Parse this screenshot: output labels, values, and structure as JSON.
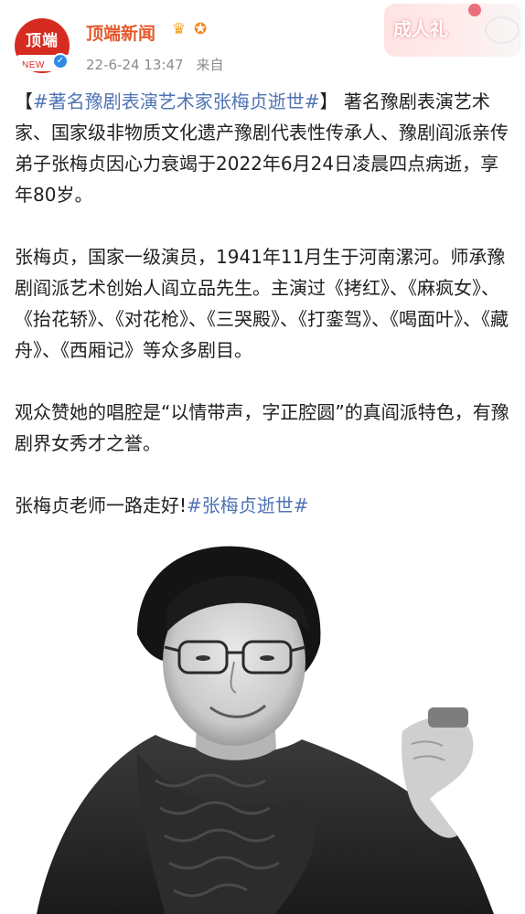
{
  "header": {
    "avatar_text": "顶端",
    "avatar_sub": "NEW",
    "author": "顶端新闻",
    "crown_icon": "crown-icon",
    "medal_icon": "medal-icon",
    "timestamp": "22-6-24 13:47",
    "source": "来自"
  },
  "badge": {
    "text": "成人礼"
  },
  "post": {
    "p1_open": "【",
    "p1_topic": "#著名豫剧表演艺术家张梅贞逝世#",
    "p1_close": "】",
    "p1_text": "著名豫剧表演艺术家、国家级非物质文化遗产豫剧代表性传承人、豫剧阎派亲传弟子张梅贞因心力衰竭于2022年6月24日凌晨四点病逝，享年80岁。",
    "p2_text": "张梅贞，国家一级演员，1941年11月生于河南漯河。师承豫剧阎派艺术创始人阎立品先生。主演过《拷红》、《麻疯女》、《抬花轿》、《对花枪》、《三哭殿》、《打銮驾》、《喝面叶》、《藏舟》、《西厢记》等众多剧目。",
    "p3_text": "观众赞她的唱腔是“以情带声，字正腔圆”的真阎派特色，有豫剧界女秀才之誉。",
    "p4_text": "张梅贞老师一路走好!",
    "p4_topic": "#张梅贞逝世#"
  },
  "colors": {
    "topic": "#4f73b4",
    "author": "#e5592b",
    "avatar_bg": "#d62b20",
    "meta": "#8b8b8b"
  }
}
